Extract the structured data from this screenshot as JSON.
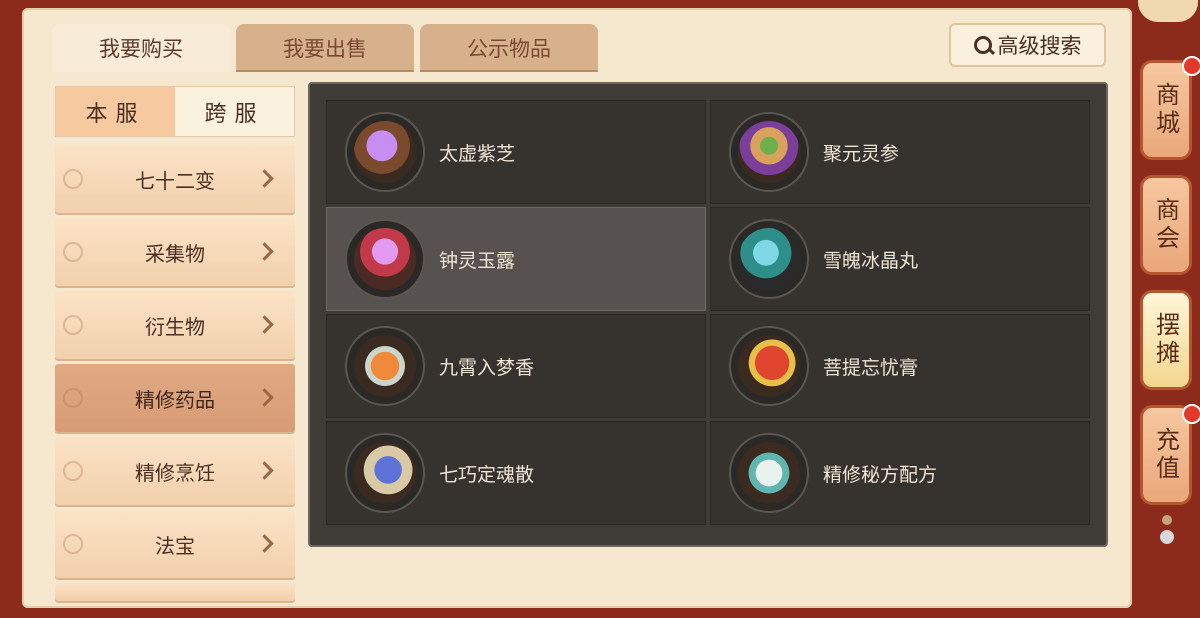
{
  "tabs": [
    "我要购买",
    "我要出售",
    "公示物品"
  ],
  "active_tab": "我要购买",
  "advanced_search_label": "高级搜索",
  "server": {
    "local": "本服",
    "cross": "跨服",
    "active": "本服"
  },
  "categories": [
    {
      "label": "七十二变"
    },
    {
      "label": "采集物"
    },
    {
      "label": "衍生物"
    },
    {
      "label": "精修药品",
      "active": true
    },
    {
      "label": "精修烹饪"
    },
    {
      "label": "法宝"
    }
  ],
  "items": [
    {
      "name": "太虚紫芝",
      "icon": "purple-lingzhi-icon"
    },
    {
      "name": "聚元灵参",
      "icon": "ginseng-icon"
    },
    {
      "name": "钟灵玉露",
      "icon": "purple-orb-icon",
      "selected": true
    },
    {
      "name": "雪魄冰晶丸",
      "icon": "crystal-box-icon"
    },
    {
      "name": "九霄入梦香",
      "icon": "incense-burner-icon"
    },
    {
      "name": "菩提忘忧膏",
      "icon": "red-jar-icon"
    },
    {
      "name": "七巧定魂散",
      "icon": "vase-icon"
    },
    {
      "name": "精修秘方配方",
      "icon": "recipe-scroll-icon"
    }
  ],
  "side_buttons": [
    {
      "label": "商城",
      "has_dot": true
    },
    {
      "label": "商会",
      "has_dot": false
    },
    {
      "label": "摆摊",
      "has_dot": false,
      "active": true
    },
    {
      "label": "充值",
      "has_dot": true
    }
  ],
  "colors": {
    "accent": "#e8a47a",
    "panel": "#f6e7cf",
    "grid_bg": "#3f3b37",
    "red_dot": "#e23a2a"
  }
}
